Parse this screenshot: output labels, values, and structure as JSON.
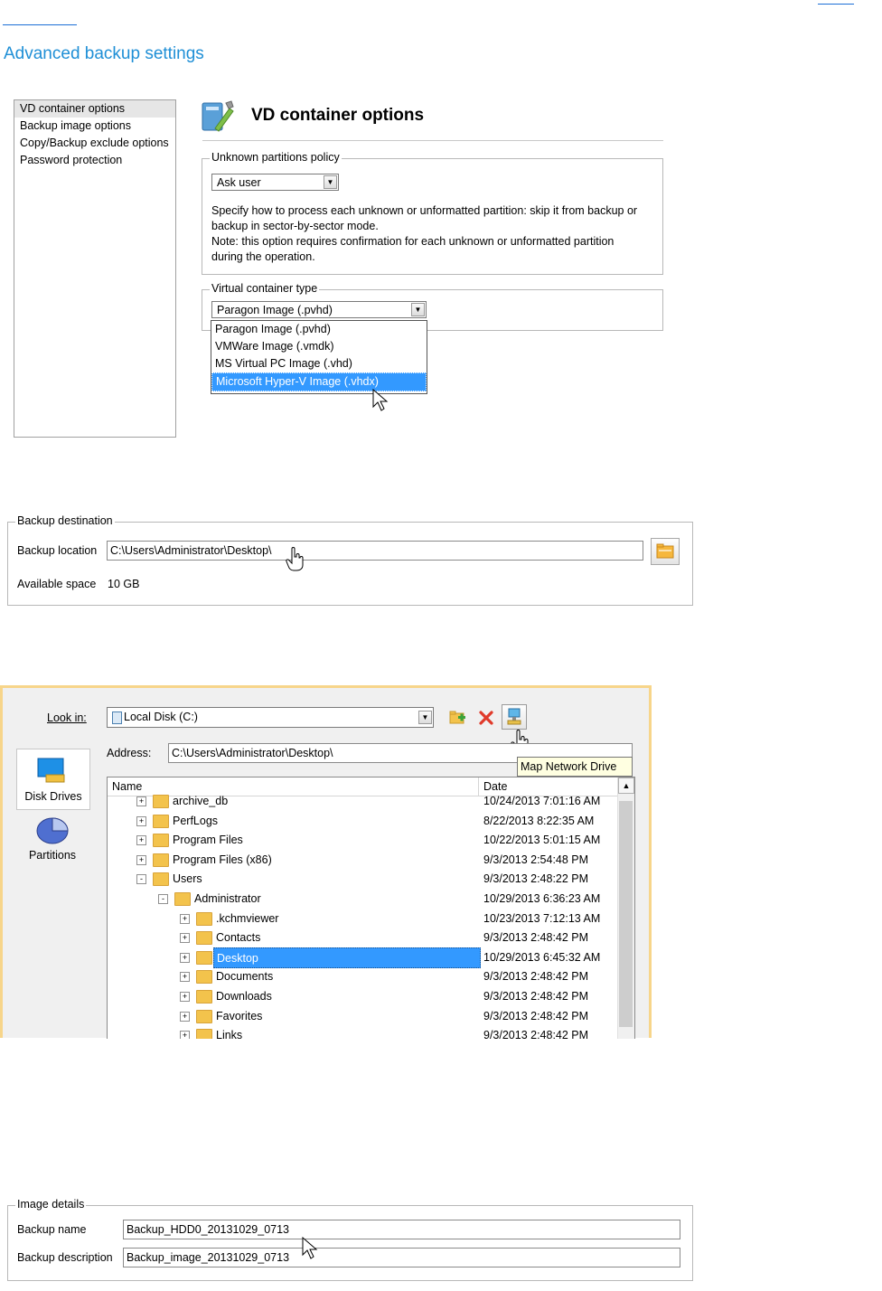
{
  "section_title": "Advanced backup settings",
  "panel1": {
    "nav_items": [
      "VD container options",
      "Backup image options",
      "Copy/Backup exclude options",
      "Password protection"
    ],
    "header_title": "VD container options",
    "unknown_policy": {
      "legend": "Unknown partitions policy",
      "selected": "Ask user",
      "desc_lines": [
        "Specify how to process each unknown or unformatted partition: skip it from backup or",
        "backup in sector-by-sector mode.",
        "Note: this option requires confirmation for each unknown or unformatted partition",
        "during the operation."
      ]
    },
    "container_type": {
      "legend": "Virtual container type",
      "selected": "Paragon Image (.pvhd)",
      "options": [
        "Paragon Image (.pvhd)",
        "VMWare Image (.vmdk)",
        "MS Virtual PC Image (.vhd)",
        "Microsoft Hyper-V Image (.vhdx)"
      ]
    }
  },
  "panel2": {
    "legend": "Backup destination",
    "location_label": "Backup location",
    "location_value": "C:\\Users\\Administrator\\Desktop\\",
    "space_label": "Available space",
    "space_value": "10 GB"
  },
  "panel3": {
    "lookin_label": "Look in:",
    "lookin_value": "Local Disk (C:)",
    "address_label": "Address:",
    "address_value": "C:\\Users\\Administrator\\Desktop\\",
    "side_items": [
      "Disk Drives",
      "Partitions"
    ],
    "tooltip": "Map Network Drive",
    "columns": [
      "Name",
      "Date"
    ],
    "rows": [
      {
        "name": "archive_db",
        "date": "10/24/2013 7:01:16 AM",
        "level": 0,
        "exp": "+"
      },
      {
        "name": "PerfLogs",
        "date": "8/22/2013 8:22:35 AM",
        "level": 0,
        "exp": "+"
      },
      {
        "name": "Program Files",
        "date": "10/22/2013 5:01:15 AM",
        "level": 0,
        "exp": "+"
      },
      {
        "name": "Program Files (x86)",
        "date": "9/3/2013 2:54:48 PM",
        "level": 0,
        "exp": "+"
      },
      {
        "name": "Users",
        "date": "9/3/2013 2:48:22 PM",
        "level": 0,
        "exp": "-"
      },
      {
        "name": "Administrator",
        "date": "10/29/2013 6:36:23 AM",
        "level": 1,
        "exp": "-"
      },
      {
        "name": ".kchmviewer",
        "date": "10/23/2013 7:12:13 AM",
        "level": 2,
        "exp": "+"
      },
      {
        "name": "Contacts",
        "date": "9/3/2013 2:48:42 PM",
        "level": 2,
        "exp": "+"
      },
      {
        "name": "Desktop",
        "date": "10/29/2013 6:45:32 AM",
        "level": 2,
        "exp": "+",
        "selected": true
      },
      {
        "name": "Documents",
        "date": "9/3/2013 2:48:42 PM",
        "level": 2,
        "exp": "+"
      },
      {
        "name": "Downloads",
        "date": "9/3/2013 2:48:42 PM",
        "level": 2,
        "exp": "+"
      },
      {
        "name": "Favorites",
        "date": "9/3/2013 2:48:42 PM",
        "level": 2,
        "exp": "+"
      },
      {
        "name": "Links",
        "date": "9/3/2013 2:48:42 PM",
        "level": 2,
        "exp": "+"
      }
    ]
  },
  "panel4": {
    "legend": "Image details",
    "name_label": "Backup name",
    "name_value": "Backup_HDD0_20131029_0713",
    "desc_label": "Backup description",
    "desc_value": "Backup_image_20131029_0713"
  },
  "colors": {
    "accent": "#1f8fd6",
    "selection": "#3399ff",
    "dialog_border": "#f7d58a"
  }
}
